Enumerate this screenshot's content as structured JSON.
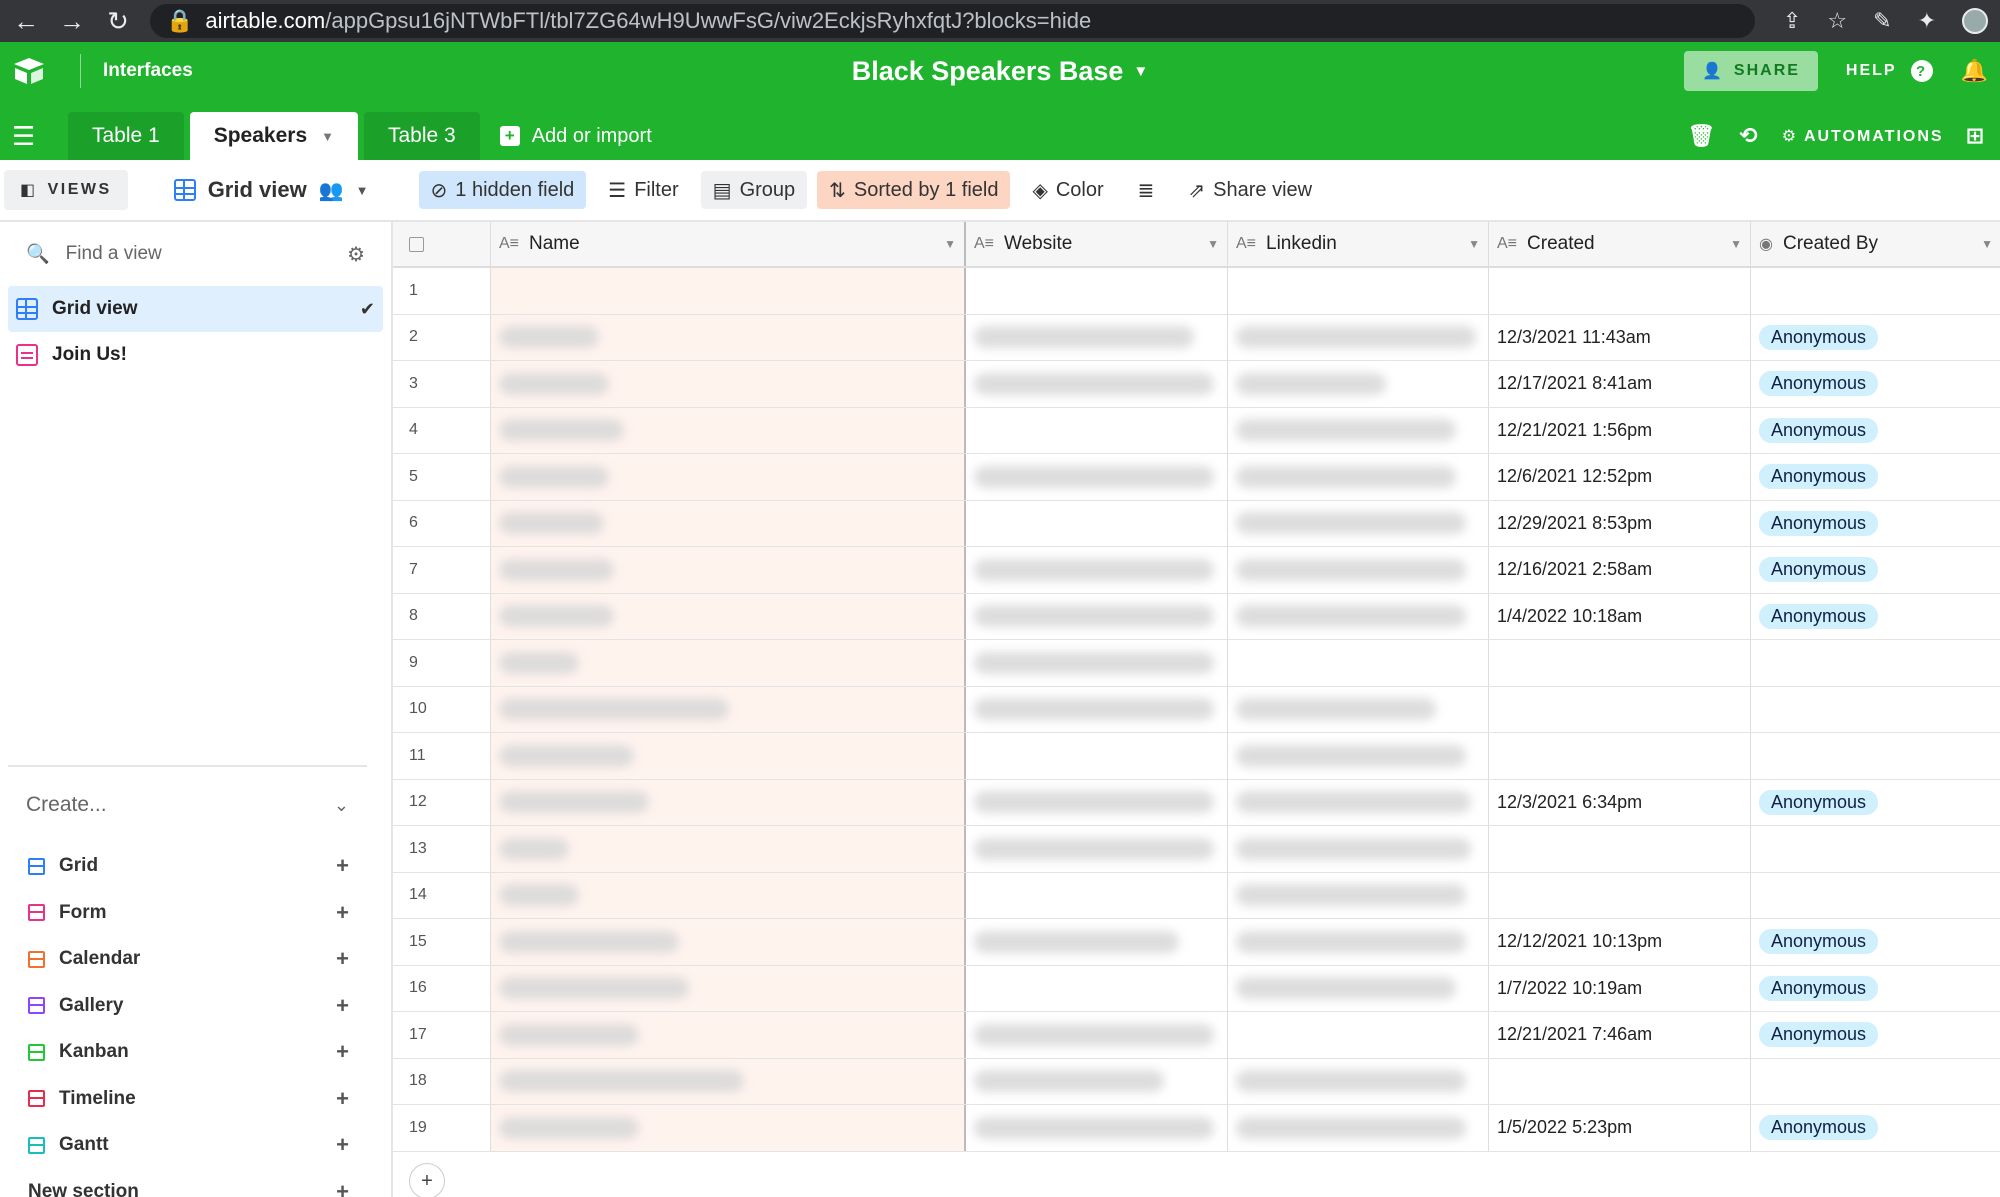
{
  "browser": {
    "url_host": "airtable.com",
    "url_path": "/appGpsu16jNTWbFTl/tbl7ZG64wH9UwwFsG/viw2EckjsRyhxfqtJ?blocks=hide"
  },
  "header": {
    "interfaces": "Interfaces",
    "base_title": "Black Speakers Base",
    "share": "SHARE",
    "help": "HELP",
    "tabs": [
      "Table 1",
      "Speakers",
      "Table 3"
    ],
    "add_import": "Add or import",
    "automations": "AUTOMATIONS",
    "colors": {
      "brand": "#1fb32e"
    }
  },
  "toolbar": {
    "views": "VIEWS",
    "view_name": "Grid view",
    "hidden": "1 hidden field",
    "filter": "Filter",
    "group": "Group",
    "sorted": "Sorted by 1 field",
    "color": "Color",
    "share_view": "Share view"
  },
  "sidebar": {
    "find_placeholder": "Find a view",
    "views": [
      "Grid view",
      "Join Us!"
    ],
    "create": "Create...",
    "create_items": [
      {
        "label": "Grid",
        "color": "#2d7ff9"
      },
      {
        "label": "Form",
        "color": "#e8318a"
      },
      {
        "label": "Calendar",
        "color": "#f2702f"
      },
      {
        "label": "Gallery",
        "color": "#8b46ff"
      },
      {
        "label": "Kanban",
        "color": "#20c933"
      },
      {
        "label": "Timeline",
        "color": "#e52e4d"
      },
      {
        "label": "Gantt",
        "color": "#18bfba"
      }
    ],
    "new_section": "New section"
  },
  "grid": {
    "columns": [
      "Name",
      "Website",
      "Linkedin",
      "Created",
      "Created By"
    ],
    "rows": [
      {
        "n": "1",
        "created": "",
        "by": ""
      },
      {
        "n": "2",
        "created": "12/3/2021 11:43am",
        "by": "Anonymous"
      },
      {
        "n": "3",
        "created": "12/17/2021 8:41am",
        "by": "Anonymous"
      },
      {
        "n": "4",
        "created": "12/21/2021 1:56pm",
        "by": "Anonymous"
      },
      {
        "n": "5",
        "created": "12/6/2021 12:52pm",
        "by": "Anonymous"
      },
      {
        "n": "6",
        "created": "12/29/2021 8:53pm",
        "by": "Anonymous"
      },
      {
        "n": "7",
        "created": "12/16/2021 2:58am",
        "by": "Anonymous"
      },
      {
        "n": "8",
        "created": "1/4/2022 10:18am",
        "by": "Anonymous"
      },
      {
        "n": "9",
        "created": "",
        "by": ""
      },
      {
        "n": "10",
        "created": "",
        "by": ""
      },
      {
        "n": "11",
        "created": "",
        "by": ""
      },
      {
        "n": "12",
        "created": "12/3/2021 6:34pm",
        "by": "Anonymous"
      },
      {
        "n": "13",
        "created": "",
        "by": ""
      },
      {
        "n": "14",
        "created": "",
        "by": ""
      },
      {
        "n": "15",
        "created": "12/12/2021 10:13pm",
        "by": "Anonymous"
      },
      {
        "n": "16",
        "created": "1/7/2022 10:19am",
        "by": "Anonymous"
      },
      {
        "n": "17",
        "created": "12/21/2021 7:46am",
        "by": "Anonymous"
      },
      {
        "n": "18",
        "created": "",
        "by": ""
      },
      {
        "n": "19",
        "created": "1/5/2022 5:23pm",
        "by": "Anonymous"
      }
    ]
  }
}
